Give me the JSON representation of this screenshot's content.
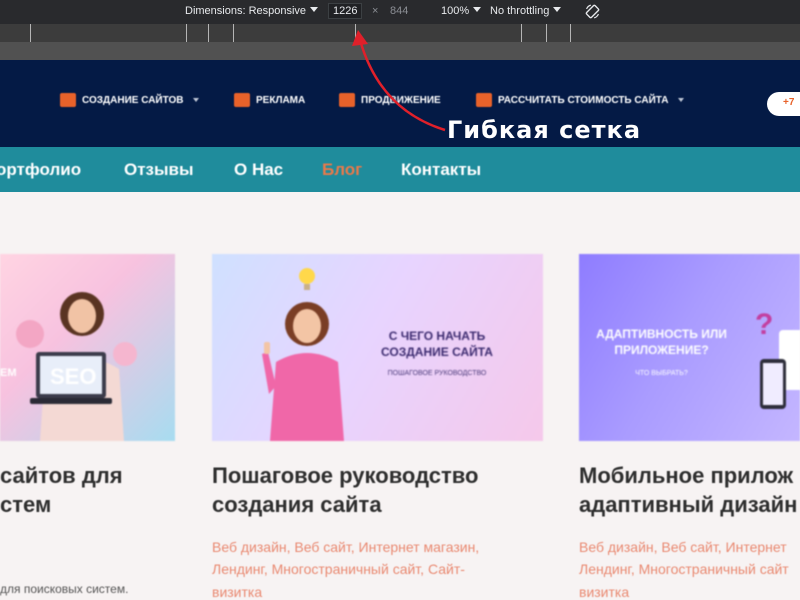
{
  "devtools": {
    "dimensions_label": "Dimensions: Responsive",
    "width_value": "1226",
    "times": "×",
    "height_value": "844",
    "zoom": "100%",
    "throttling": "No throttling"
  },
  "header": {
    "nav": [
      {
        "label": "СОЗДАНИЕ САЙТОВ",
        "has_dropdown": true
      },
      {
        "label": "РЕКЛАМА",
        "has_dropdown": false
      },
      {
        "label": "ПРОДВИЖЕНИЕ",
        "has_dropdown": false
      },
      {
        "label": "РАССЧИТАТЬ СТОИМОСТЬ САЙТА",
        "has_dropdown": true
      }
    ],
    "cta_label": "+7",
    "accent_color": "#e8622a",
    "bg_color": "#041a45"
  },
  "annotation": {
    "text": "Гибкая сетка",
    "arrow_color": "#e0202a"
  },
  "subnav": {
    "items": [
      {
        "label": "ортфолио"
      },
      {
        "label": "Отзывы"
      },
      {
        "label": "О Нас"
      },
      {
        "label": "Блог",
        "active": true
      },
      {
        "label": "Контакты"
      }
    ],
    "bg_color": "#1f8c9c"
  },
  "cards": [
    {
      "image_text": "ЕМ",
      "image_word": "SEO",
      "title_lines": [
        "сайтов для",
        "стем"
      ],
      "tags": "",
      "desc": "для поисковых систем."
    },
    {
      "image_text_lines": [
        "С ЧЕГО НАЧАТЬ",
        "СОЗДАНИЕ САЙТА"
      ],
      "image_sub": "ПОШАГОВОЕ РУКОВОДСТВО",
      "title_lines": [
        "Пошаговое руководство",
        "создания сайта"
      ],
      "tags_lines": [
        "Веб дизайн, Веб сайт, Интернет магазин,",
        "Лендинг, Многостраничный сайт, Сайт-",
        "визитка"
      ]
    },
    {
      "image_text_lines": [
        "АДАПТИВНОСТЬ ИЛИ",
        "ПРИЛОЖЕНИЕ?"
      ],
      "image_sub": "ЧТО ВЫБРАТЬ?",
      "title_lines": [
        "Мобильное прилож",
        "адаптивный дизайн"
      ],
      "tags_lines": [
        "Веб дизайн, Веб сайт, Интернет",
        "Лендинг, Многостраничный сайт",
        "визитка"
      ]
    }
  ]
}
